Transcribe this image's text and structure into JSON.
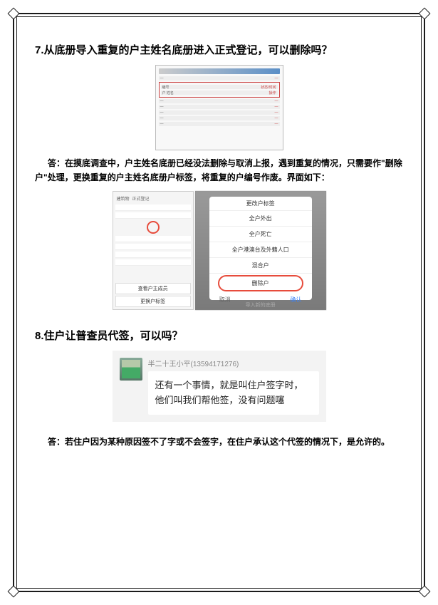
{
  "q7": {
    "heading": "7.从底册导入重复的户主姓名底册进入正式登记，可以删除吗？",
    "answer": "答：在摸底调查中，户主姓名底册已经没法删除与取消上报，遇到重复的情况，只需要作\"删除户\"处理，更换重复的户主姓名底册户标签，将重复的户编号作废。界面如下：",
    "shot1": {
      "rows": [
        {
          "l": "编号",
          "r": "状态/时间"
        },
        {
          "l": "户 姓名",
          "r": "操作"
        }
      ]
    },
    "shot2": {
      "left": {
        "tabs": [
          "建筑物",
          "正式登记"
        ],
        "btn1": "查看户主成员",
        "btn2": "更换户标签"
      },
      "right": {
        "title": "更改户标签",
        "opts": [
          "全户外出",
          "全户死亡",
          "全户港澳台及外籍人口",
          "混合户"
        ],
        "selected": "删除户",
        "cancel": "取消",
        "confirm": "确认",
        "under": "导入新的底册"
      }
    }
  },
  "q8": {
    "heading": "8.住户让普查员代签，可以吗？",
    "chat": {
      "name": "半二十王小平(13594171276)",
      "message": "还有一个事情，就是叫住户签字时，他们叫我们帮他签，没有问题噻"
    },
    "answer": "答：若住户因为某种原因签不了字或不会签字，在住户承认这个代签的情况下，是允许的。"
  }
}
